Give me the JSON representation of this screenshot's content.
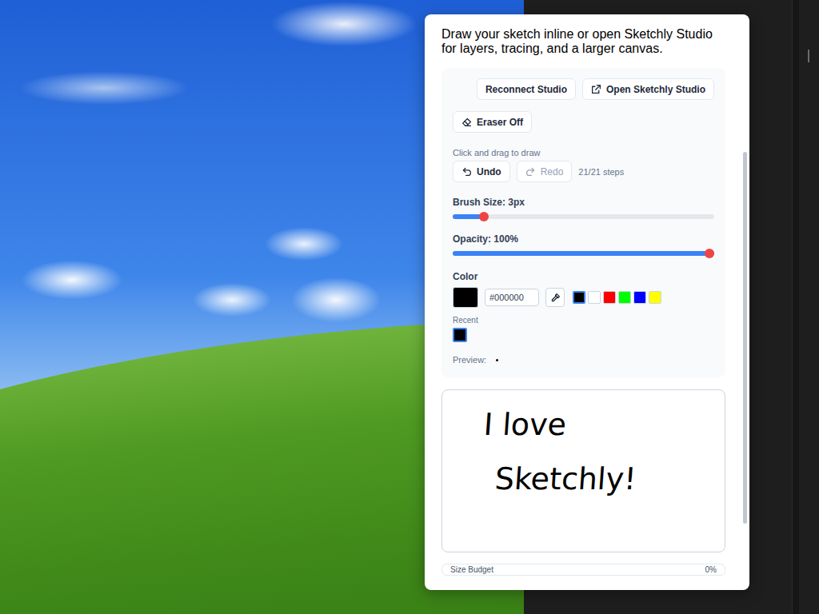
{
  "intro": "Draw your sketch inline or open Sketchly Studio for layers, tracing, and a larger canvas.",
  "studio_buttons": [
    {
      "label": "Reconnect Studio",
      "kind": "plain"
    },
    {
      "label": "Open Sketchly Studio",
      "kind": "external"
    }
  ],
  "eraser": {
    "label": "Eraser Off",
    "on": false
  },
  "hint": "Click and drag to draw",
  "undo": {
    "label": "Undo",
    "disabled": false
  },
  "redo": {
    "label": "Redo",
    "disabled": true
  },
  "steps": "21/21 steps",
  "sliders": [
    {
      "label": "Brush Size: 3px",
      "level": 0.12
    },
    {
      "label": "Opacity: 100%",
      "level": 1
    }
  ],
  "color": {
    "label": "Color",
    "current": "#000000",
    "hex": "#000000",
    "swatches": [
      {
        "color": "#000000",
        "selected": true
      },
      {
        "color": "#ffffff",
        "selected": false
      },
      {
        "color": "#ff0000",
        "selected": false
      },
      {
        "color": "#00ff00",
        "selected": false
      },
      {
        "color": "#0000ff",
        "selected": false
      },
      {
        "color": "#ffff00",
        "selected": false
      }
    ],
    "recent_label": "Recent",
    "recent": [
      {
        "color": "#000000",
        "selected": true
      }
    ],
    "preview_label": "Preview:"
  },
  "canvas": {
    "lines": [
      "I love",
      "Sketchly!"
    ]
  },
  "size_budget": {
    "label": "Size Budget",
    "reading": "0%"
  }
}
